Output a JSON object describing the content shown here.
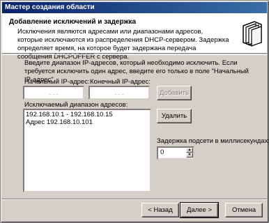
{
  "window": {
    "title": "Мастер создания области"
  },
  "header": {
    "title": "Добавление исключений и задержка",
    "description": "Исключения являются адресами или диапазонами адресов, которые исключаются из распределения DHCP-сервером. Задержка определяет время, на которое будет задержана передача сообщения DHCPOFFER с сервера."
  },
  "instructions": "Введите диапазон IP-адресов, который необходимо исключить. Если требуется исключить один адрес, введите его только в поле \"Начальный IP-адрес\".",
  "start_ip": {
    "label": "Начальный IP-адрес:",
    "value": ". . ."
  },
  "end_ip": {
    "label": "Конечный IP-адрес:",
    "value": ". . ."
  },
  "add_button": {
    "label": "Добавить"
  },
  "excluded": {
    "label": "Исключаемый диапазон адресов:",
    "items": [
      "192.168.10.1 - 192.168.10.15",
      "Адрес 192.168.10.101"
    ]
  },
  "remove_button": {
    "label": "Удалить"
  },
  "delay": {
    "label": "Задержка подсети в миллисекундах:",
    "value": "0"
  },
  "footer": {
    "back_label": "< Назад",
    "next_label": "Далее >",
    "cancel_label": "Отмена"
  }
}
